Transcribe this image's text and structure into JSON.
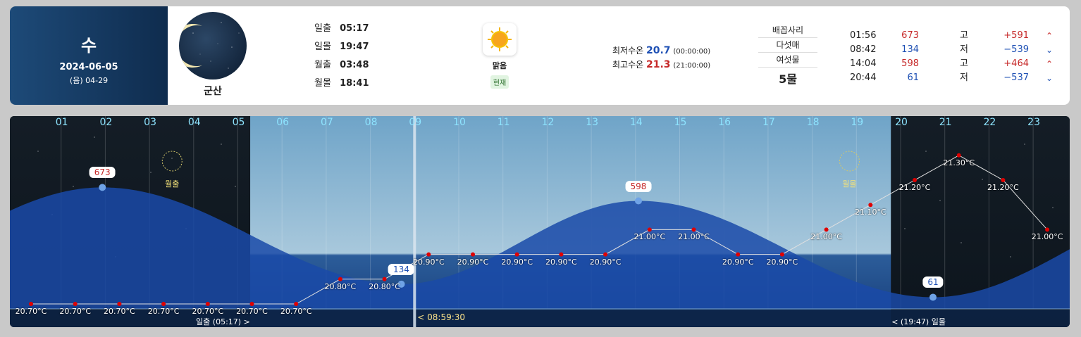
{
  "date_box": {
    "day_of_week": "수",
    "date": "2024-06-05",
    "lunar": "(음) 04-29"
  },
  "station": "군산",
  "sun_moon": [
    {
      "label": "일출",
      "time": "05:17"
    },
    {
      "label": "일몰",
      "time": "19:47"
    },
    {
      "label": "월출",
      "time": "03:48"
    },
    {
      "label": "월몰",
      "time": "18:41"
    }
  ],
  "weather": {
    "label": "맑음",
    "badge": "현재",
    "icon": "sun-icon"
  },
  "water_temp": {
    "min_label": "최저수온",
    "min_value": "20.7",
    "min_time": "(00:00:00)",
    "max_label": "최고수온",
    "max_value": "21.3",
    "max_time": "(21:00:00)"
  },
  "mul": {
    "items": [
      "배꼽사리",
      "다섯매",
      "여섯물"
    ],
    "current": "5물"
  },
  "tides": [
    {
      "time": "01:56",
      "level": "673",
      "type": "고",
      "diff": "+591",
      "dir": "up"
    },
    {
      "time": "08:42",
      "level": "134",
      "type": "저",
      "diff": "−539",
      "dir": "down"
    },
    {
      "time": "14:04",
      "level": "598",
      "type": "고",
      "diff": "+464",
      "dir": "up"
    },
    {
      "time": "20:44",
      "level": "61",
      "type": "저",
      "diff": "−537",
      "dir": "down"
    }
  ],
  "colors": {
    "high": "#c62828",
    "low": "#1e50b4",
    "hour_label": "#8ee4ff",
    "tide_fill": "#1a4aa8"
  },
  "chart_data": {
    "type": "area",
    "hours": [
      "01",
      "02",
      "03",
      "04",
      "05",
      "06",
      "07",
      "08",
      "09",
      "10",
      "11",
      "12",
      "13",
      "14",
      "15",
      "16",
      "17",
      "18",
      "19",
      "20",
      "21",
      "22",
      "23"
    ],
    "tide_extremes": [
      {
        "time": "01:56",
        "value": 673
      },
      {
        "time": "08:42",
        "value": 134
      },
      {
        "time": "14:04",
        "value": 598
      },
      {
        "time": "20:44",
        "value": 61
      }
    ],
    "water_temperature": {
      "hours": [
        0,
        1,
        2,
        3,
        4,
        5,
        6,
        7,
        8,
        9,
        10,
        11,
        12,
        13,
        14,
        15,
        16,
        17,
        18,
        19,
        20,
        21,
        22,
        23
      ],
      "labels": [
        "20.70°C",
        "20.70°C",
        "20.70°C",
        "20.70°C",
        "20.70°C",
        "20.70°C",
        "20.70°C",
        "20.80°C",
        "20.80°C",
        "20.90°C",
        "20.90°C",
        "20.90°C",
        "20.90°C",
        "20.90°C",
        "21.00°C",
        "21.00°C",
        "20.90°C",
        "20.90°C",
        "21.00°C",
        "21.10°C",
        "21.20°C",
        "21.30°C",
        "21.20°C",
        "21.00°C"
      ],
      "values": [
        20.7,
        20.7,
        20.7,
        20.7,
        20.7,
        20.7,
        20.7,
        20.8,
        20.8,
        20.9,
        20.9,
        20.9,
        20.9,
        20.9,
        21.0,
        21.0,
        20.9,
        20.9,
        21.0,
        21.1,
        21.2,
        21.3,
        21.2,
        21.0
      ]
    },
    "moonrise_label": "월출",
    "moonset_label": "월몰",
    "moonrise_time": "03:48",
    "moonset_time": "18:41",
    "current_time": "< 08:59:30",
    "current_hour": 9.0,
    "sunrise_text": "일출 (05:17)  >",
    "sunset_text": "<  (19:47)  일몰",
    "sunrise_hour": 5.28,
    "sunset_hour": 19.78
  }
}
